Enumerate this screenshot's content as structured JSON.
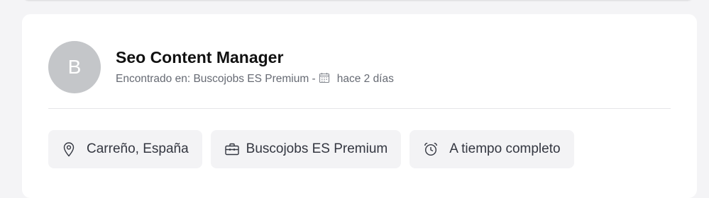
{
  "job": {
    "avatar_letter": "B",
    "title": "Seo Content Manager",
    "found_in_label": "Encontrado en: Buscojobs ES Premium -",
    "posted": "hace 2 días"
  },
  "chips": {
    "location": "Carreño, España",
    "company": "Buscojobs ES Premium",
    "schedule": "A tiempo completo"
  },
  "icons": {
    "calendar": "calendar-icon",
    "location": "map-pin-icon",
    "company": "briefcase-icon",
    "schedule": "alarm-clock-icon"
  }
}
